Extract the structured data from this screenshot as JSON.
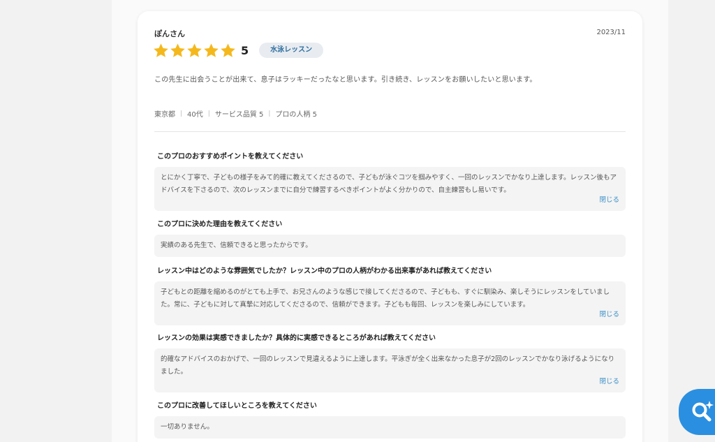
{
  "review": {
    "reviewer": "ぽんさん",
    "date": "2023/11",
    "rating": 5,
    "rating_label": "5",
    "service_tag": "水泳レッスン",
    "comment": "この先生に出会うことが出来て、息子はラッキーだったなと思います。引き続き、レッスンをお願いしたいと思います。",
    "meta": {
      "location": "東京都",
      "age": "40代",
      "service_quality": "サービス品質 5",
      "personality": "プロの人柄 5"
    }
  },
  "qa": [
    {
      "question": "このプロのおすすめポイントを教えてください",
      "answer": "とにかく丁寧で、子どもの様子をみて的確に教えてくださるので、子どもが泳ぐコツを掴みやすく、一回のレッスンでかなり上達します。レッスン後もアドバイスを下さるので、次のレッスンまでに自分で練習するべきポイントがよく分かりので、自主練習もし易いです。",
      "close_label": "閉じる"
    },
    {
      "question": "このプロに決めた理由を教えてください",
      "answer": "実績のある先生で、信頼できると思ったからです。"
    },
    {
      "question": "レッスン中はどのような雰囲気でしたか？レッスン中のプロの人柄がわかる出来事があれば教えてください",
      "answer": "子どもとの距離を縮めるのがとても上手で、お兄さんのような感じで接してくださるので、子どもも、すぐに馴染み、楽しそうにレッスンをしていました。常に、子どもに対して真摯に対応してくださるので、信頼ができます。子どもも毎回、レッスンを楽しみにしています。",
      "close_label": "閉じる"
    },
    {
      "question": "レッスンの効果は実感できましたか？具体的に実感できるところがあれば教えてください",
      "answer": "的確なアドバイスのおかげで、一回のレッスンで見違えるように上達します。平泳ぎが全く出来なかった息子が2回のレッスンでかなり泳げるようになりました。",
      "close_label": "閉じる"
    },
    {
      "question": "このプロに改善してほしいところを教えてください",
      "answer": "一切ありません。"
    }
  ],
  "colors": {
    "star": "#f5b81c",
    "link": "#3a8fc8",
    "fab": "#2a8fe0",
    "tag_bg": "#e8ecf1",
    "tag_text": "#2e6e9e"
  },
  "icons": {
    "star": "star-icon",
    "fab": "search-sparkle-icon"
  }
}
